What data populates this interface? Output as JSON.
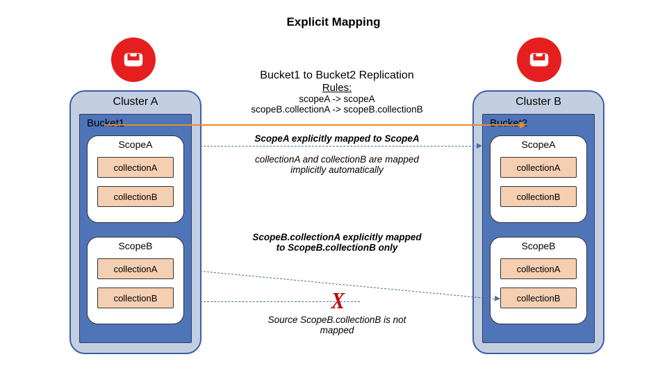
{
  "title": "Explicit Mapping",
  "header": {
    "line1": "Bucket1 to Bucket2 Replication",
    "rules_label": "Rules:",
    "rule1": "scopeA -> scopeA",
    "rule2": "scopeB.collectionA -> scopeB.collectionB"
  },
  "left": {
    "cluster": "Cluster A",
    "bucket": "Bucket1",
    "scopeA": "ScopeA",
    "scopeA_c1": "collectionA",
    "scopeA_c2": "collectionB",
    "scopeB": "ScopeB",
    "scopeB_c1": "collectionA",
    "scopeB_c2": "collectionB"
  },
  "right": {
    "cluster": "Cluster B",
    "bucket": "Bucket2",
    "scopeA": "ScopeA",
    "scopeA_c1": "collectionA",
    "scopeA_c2": "collectionB",
    "scopeB": "ScopeB",
    "scopeB_c1": "collectionA",
    "scopeB_c2": "collectionB"
  },
  "annotations": {
    "scopeA_map": "ScopeA explicitly mapped to ScopeA",
    "scopeA_impl": "collectionA and collectionB are mapped implicitly automatically",
    "scopeB_map_l1": "ScopeB.collectionA explicitly mapped",
    "scopeB_map_l2": "to ScopeB.collectionB only",
    "xmark": "X",
    "not_mapped_l1": "Source ScopeB.collectionB is not",
    "not_mapped_l2": "mapped"
  },
  "colors": {
    "brand_red": "#e51f1f",
    "arrow_orange": "#e88b2d",
    "arrow_blue": "#4a6fa5",
    "x_red": "#c00000"
  }
}
